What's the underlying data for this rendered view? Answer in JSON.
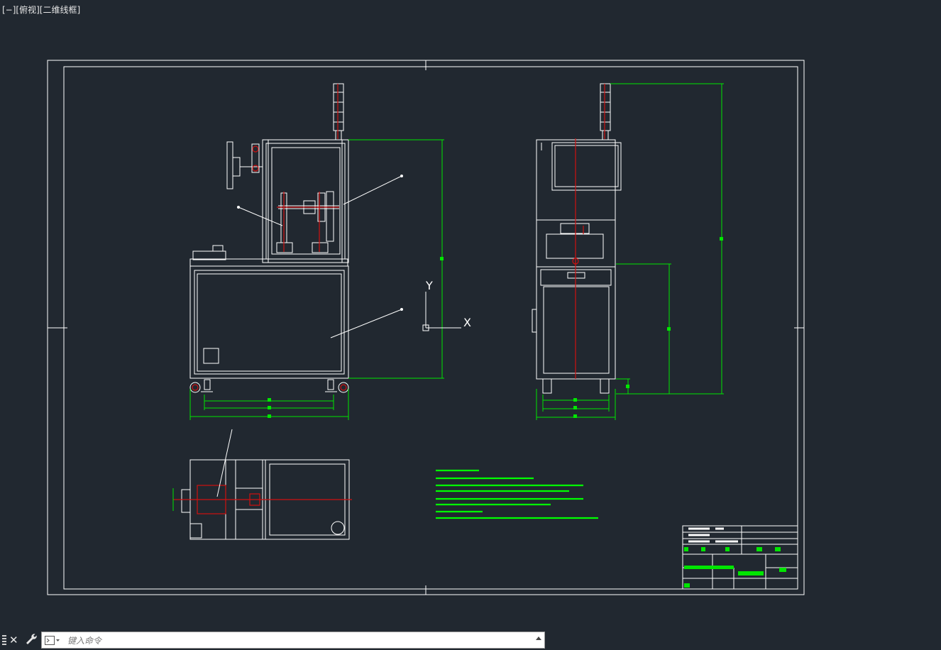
{
  "viewport": {
    "label": "[−][俯视][二维线框]"
  },
  "ucs": {
    "x_label": "X",
    "y_label": "Y"
  },
  "commandline": {
    "placeholder": "键入命令"
  },
  "colors": {
    "background": "#212830",
    "line": "#ffffff",
    "dimension": "#00e600",
    "centerline": "#d01010",
    "annotation": "#00ff00"
  },
  "icons": [
    "grip-icon",
    "close-icon",
    "wrench-icon",
    "command-prompt-icon",
    "scroll-up-icon"
  ]
}
